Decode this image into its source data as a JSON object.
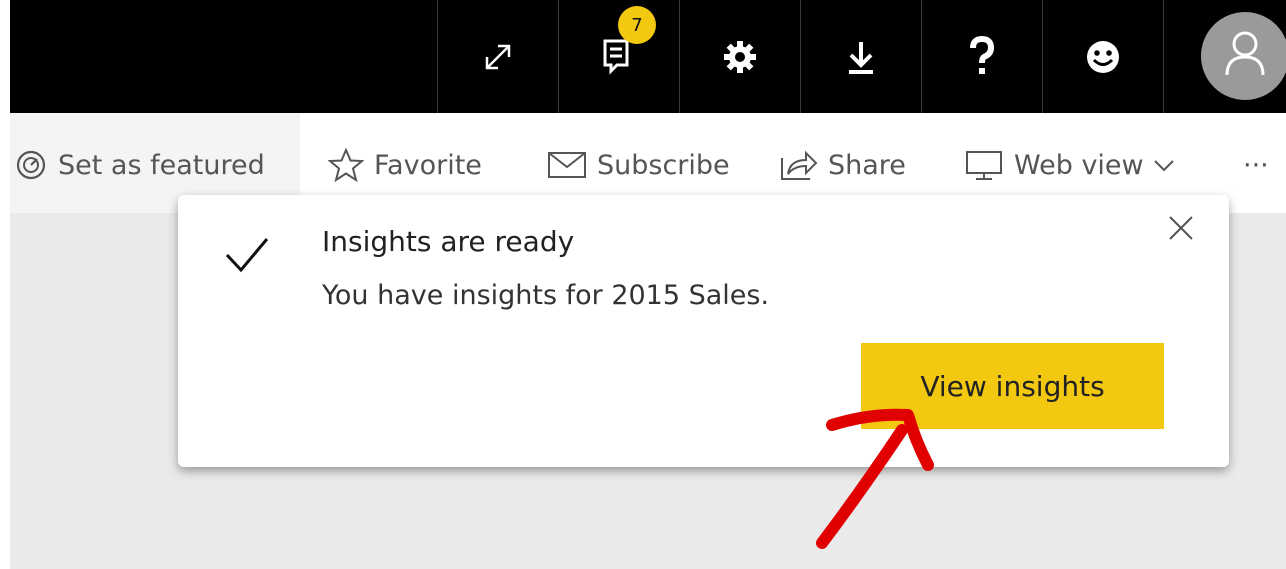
{
  "topbar": {
    "notification_count": "7",
    "icons": [
      "expand-icon",
      "notifications-icon",
      "settings-icon",
      "download-icon",
      "help-icon",
      "feedback-icon",
      "account-icon"
    ]
  },
  "actionbar": {
    "set_featured": "Set as featured",
    "favorite": "Favorite",
    "subscribe": "Subscribe",
    "share": "Share",
    "web_view": "Web view",
    "more": "···"
  },
  "toast": {
    "title": "Insights are ready",
    "message": "You have insights for 2015 Sales.",
    "button": "View insights"
  },
  "colors": {
    "accent": "#f2c811",
    "topbar": "#000000",
    "annotation_arrow": "#e10000"
  }
}
